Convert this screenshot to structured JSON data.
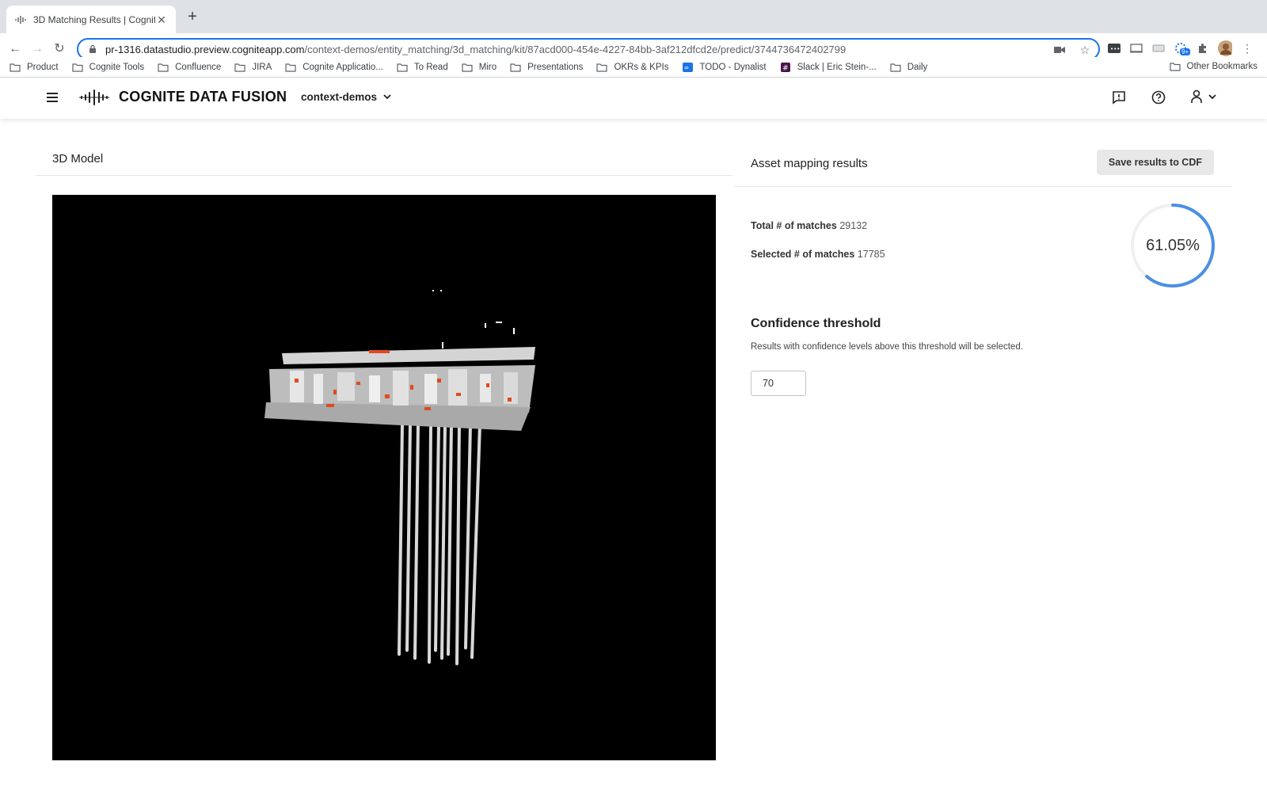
{
  "browser": {
    "tab_title": "3D Matching Results | Cognite",
    "url_host": "pr-1316.datastudio.preview.cogniteapp.com",
    "url_path": "/context-demos/entity_matching/3d_matching/kit/87acd000-454e-4227-84bb-3af212dfcd2e/predict/3744736472402799",
    "extension_badge": "9+",
    "bookmarks": [
      {
        "label": "Product",
        "icon": "folder-icon"
      },
      {
        "label": "Cognite Tools",
        "icon": "folder-icon"
      },
      {
        "label": "Confluence",
        "icon": "folder-icon"
      },
      {
        "label": "JIRA",
        "icon": "folder-icon"
      },
      {
        "label": "Cognite Applicatio...",
        "icon": "folder-icon"
      },
      {
        "label": "To Read",
        "icon": "folder-icon"
      },
      {
        "label": "Miro",
        "icon": "folder-icon"
      },
      {
        "label": "Presentations",
        "icon": "folder-icon"
      },
      {
        "label": "OKRs & KPIs",
        "icon": "folder-icon"
      },
      {
        "label": "TODO - Dynalist",
        "icon": "dynalist-icon"
      },
      {
        "label": "Slack | Eric Stein-...",
        "icon": "slack-icon"
      },
      {
        "label": "Daily",
        "icon": "folder-icon"
      }
    ],
    "other_bookmarks": "Other Bookmarks"
  },
  "app": {
    "brand": "COGNITE DATA FUSION",
    "project": "context-demos"
  },
  "left_panel": {
    "title": "3D Model"
  },
  "right_panel": {
    "title": "Asset mapping results",
    "save_button": "Save results to CDF",
    "total_label": "Total # of matches",
    "total_value": "29132",
    "selected_label": "Selected # of matches",
    "selected_value": "17785",
    "percent_text": "61.05%",
    "percent_fraction": 0.6105,
    "gauge_color": "#4a90e2",
    "confidence_title": "Confidence threshold",
    "confidence_desc": "Results with confidence levels above this threshold will be selected.",
    "confidence_value": "70"
  }
}
